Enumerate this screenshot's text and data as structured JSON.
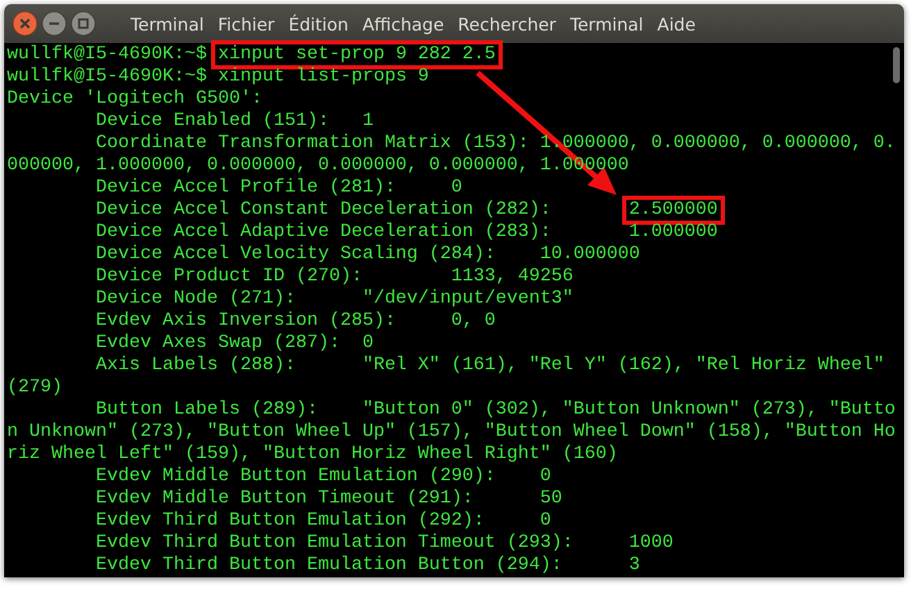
{
  "window": {
    "app_name": "Terminal",
    "menu": [
      "Fichier",
      "Édition",
      "Affichage",
      "Rechercher",
      "Terminal",
      "Aide"
    ]
  },
  "lines": [
    {
      "text": "wullfk@I5-4690K:~$ ",
      "value": "xinput set-prop 9 282 2.5",
      "boxed": true
    },
    {
      "text": "wullfk@I5-4690K:~$ ",
      "value": "xinput list-props 9",
      "boxed": false
    },
    {
      "text": "Device 'Logitech G500':"
    },
    {
      "text": "        Device Enabled (151):   1"
    },
    {
      "text": "        Coordinate Transformation Matrix (153): 1.000000, 0.000000, 0.000000, 0."
    },
    {
      "text": "000000, 1.000000, 0.000000, 0.000000, 0.000000, 1.000000"
    },
    {
      "text": "        Device Accel Profile (281):     0"
    },
    {
      "text": "        Device Accel Constant Deceleration (282):       ",
      "value": "2.500000",
      "boxed": true
    },
    {
      "text": "        Device Accel Adaptive Deceleration (283):       ",
      "value": "1.000000",
      "boxed": false
    },
    {
      "text": "        Device Accel Velocity Scaling (284):    10.000000"
    },
    {
      "text": "        Device Product ID (270):        1133, 49256"
    },
    {
      "text": "        Device Node (271):      \"/dev/input/event3\""
    },
    {
      "text": "        Evdev Axis Inversion (285):     0, 0"
    },
    {
      "text": "        Evdev Axes Swap (287):  0"
    },
    {
      "text": "        Axis Labels (288):      \"Rel X\" (161), \"Rel Y\" (162), \"Rel Horiz Wheel\""
    },
    {
      "text": "(279)"
    },
    {
      "text": "        Button Labels (289):    \"Button 0\" (302), \"Button Unknown\" (273), \"Butto"
    },
    {
      "text": "n Unknown\" (273), \"Button Wheel Up\" (157), \"Button Wheel Down\" (158), \"Button Ho"
    },
    {
      "text": "riz Wheel Left\" (159), \"Button Horiz Wheel Right\" (160)"
    },
    {
      "text": "        Evdev Middle Button Emulation (290):    0"
    },
    {
      "text": "        Evdev Middle Button Timeout (291):      50"
    },
    {
      "text": "        Evdev Third Button Emulation (292):     0"
    },
    {
      "text": "        Evdev Third Button Emulation Timeout (293):     1000"
    },
    {
      "text": "        Evdev Third Button Emulation Button (294):      3"
    }
  ]
}
